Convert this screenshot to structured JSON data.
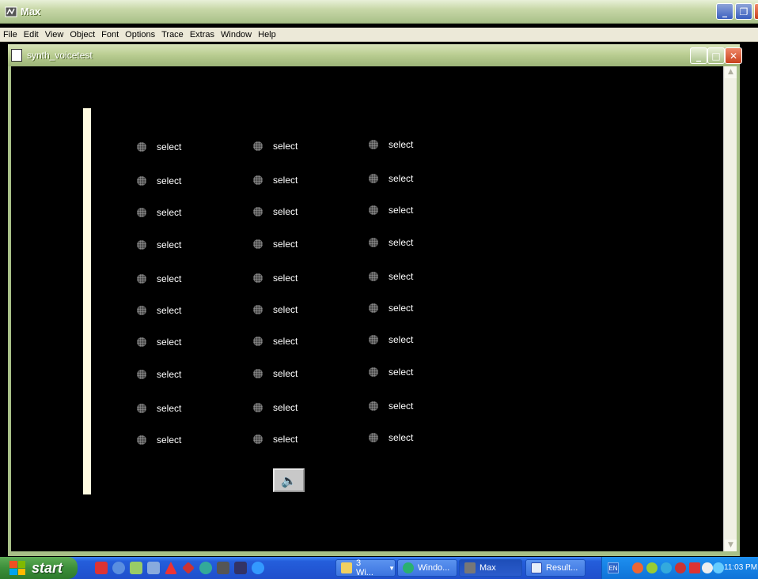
{
  "app": {
    "title": "Max",
    "menu": [
      "File",
      "Edit",
      "View",
      "Object",
      "Font",
      "Options",
      "Trace",
      "Extras",
      "Window",
      "Help"
    ]
  },
  "patcher": {
    "title": "synth_voicetest",
    "select_objects": {
      "label": "select",
      "rows": 10,
      "columns": 3
    },
    "speaker_icon": "speaker-icon"
  },
  "taskbar": {
    "start_label": "start",
    "tasks": [
      {
        "label": "3 Wi...",
        "icon": "folder-icon"
      },
      {
        "label": "Windo...",
        "icon": "media-icon"
      },
      {
        "label": "Max",
        "icon": "max-icon",
        "active": true
      },
      {
        "label": "Result...",
        "icon": "word-icon"
      }
    ],
    "tray_lang": "EN",
    "clock": "11:03 PM"
  }
}
